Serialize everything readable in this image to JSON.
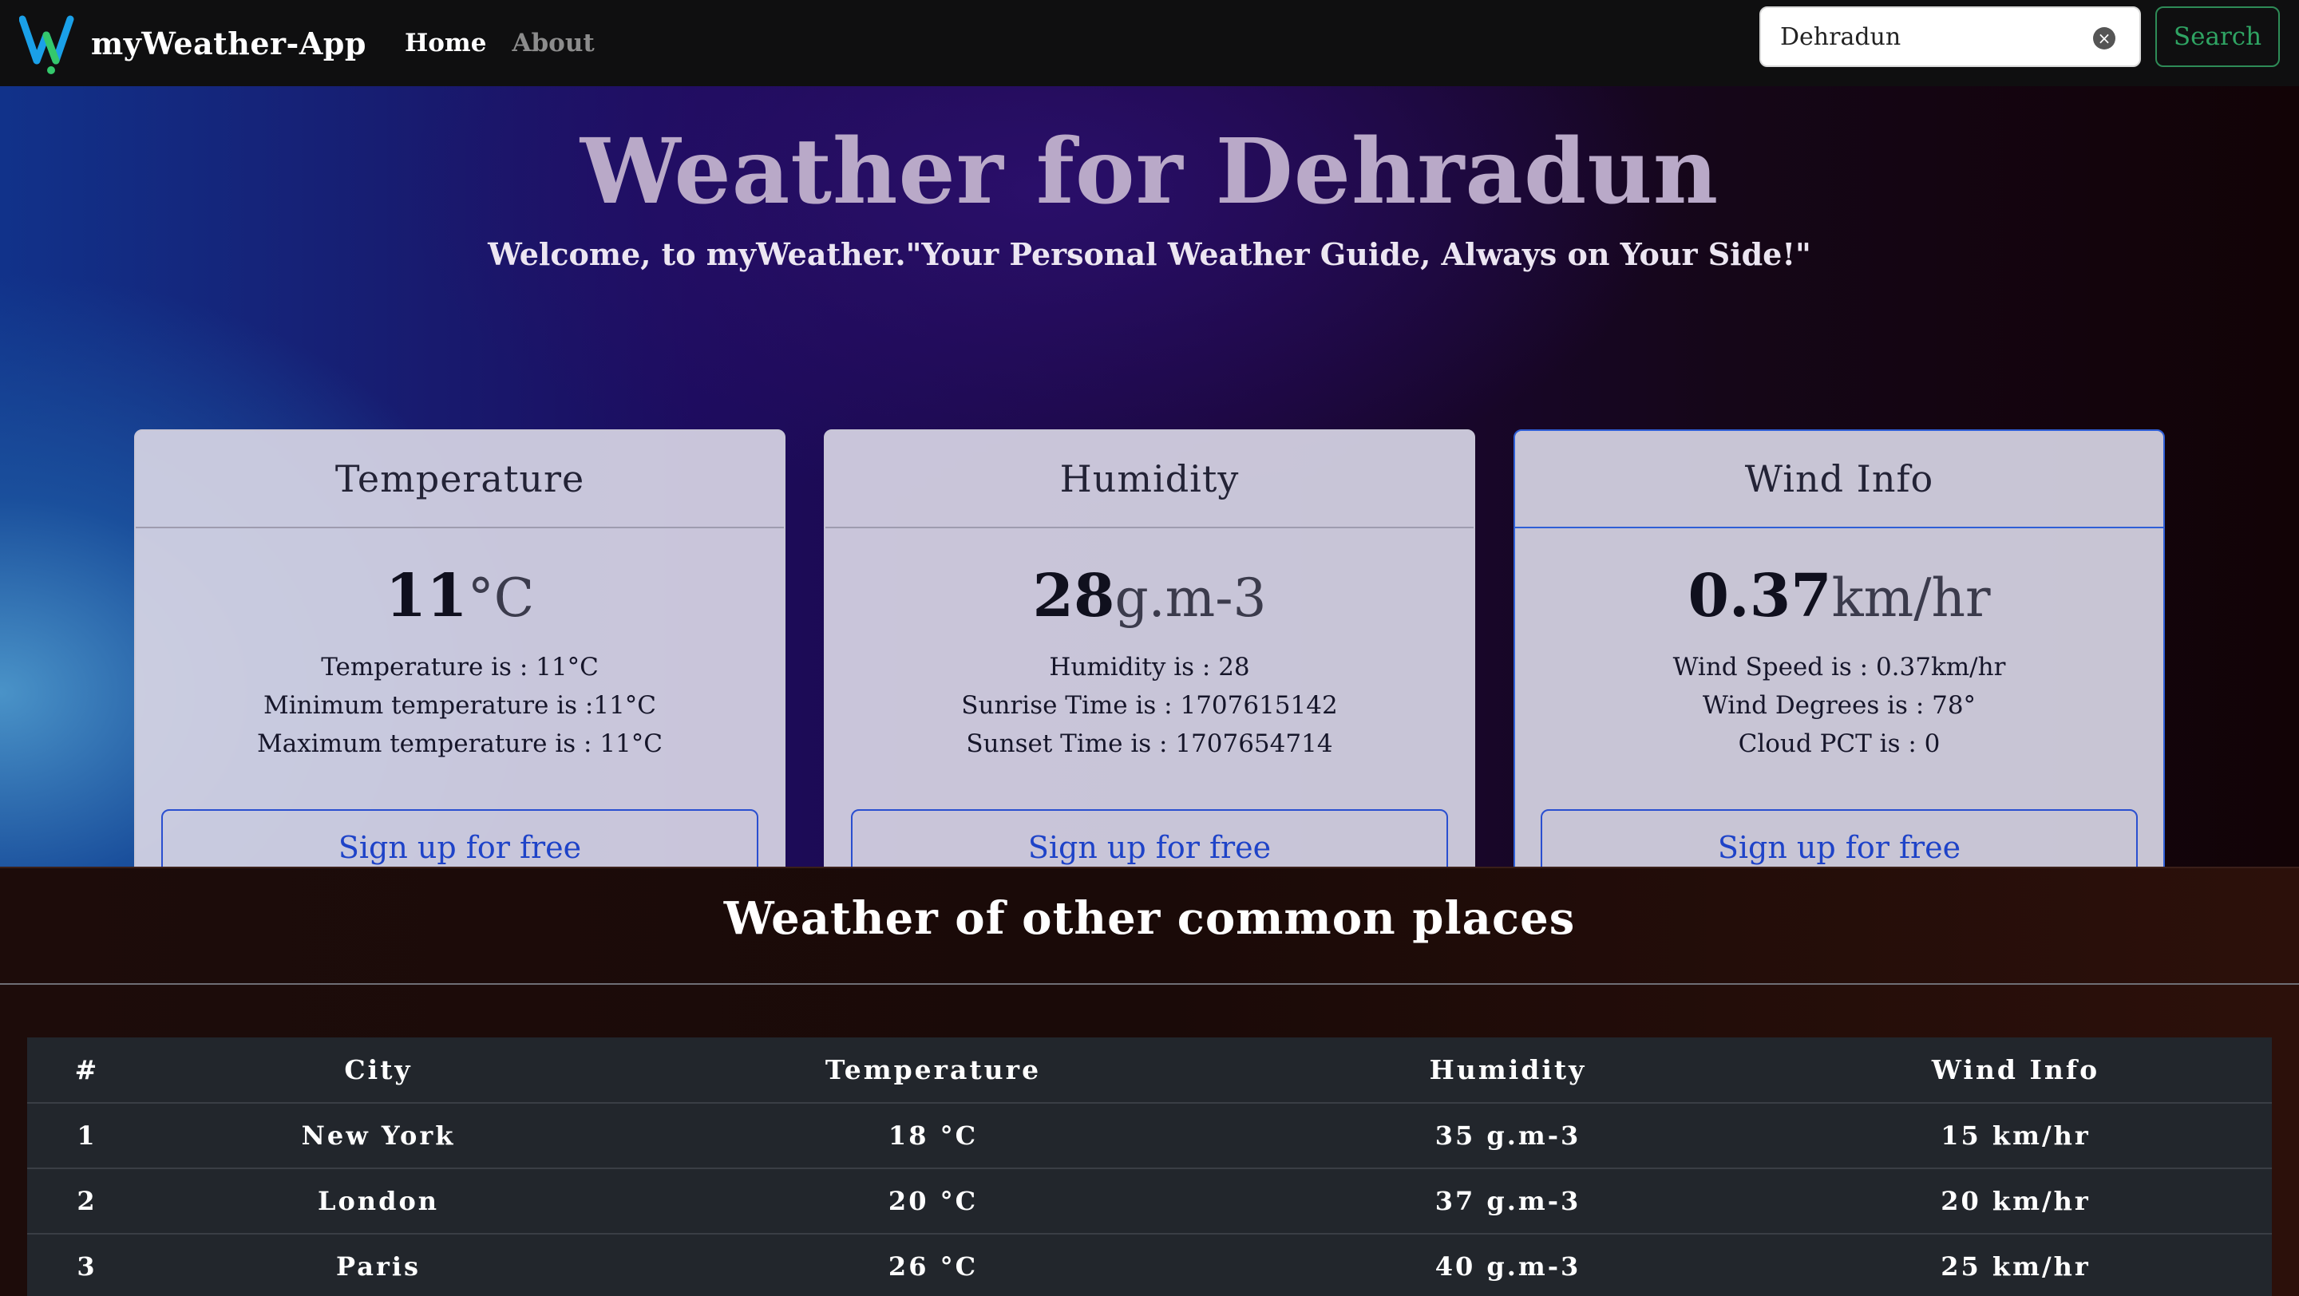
{
  "nav": {
    "brand": "myWeather-App",
    "home": "Home",
    "about": "About",
    "search_value": "Dehradun",
    "search_button": "Search",
    "clear_glyph": "×"
  },
  "hero": {
    "title": "Weather for Dehradun",
    "subtitle": "Welcome, to myWeather.\"Your Personal Weather Guide, Always on Your Side!\""
  },
  "cards": [
    {
      "title": "Temperature",
      "value": "11",
      "unit": "°C",
      "lines": [
        "Temperature is : 11°C",
        "Minimum temperature is :11°C",
        "Maximum temperature is : 11°C"
      ],
      "button": "Sign up for free"
    },
    {
      "title": "Humidity",
      "value": "28",
      "unit": "g.m-3",
      "lines": [
        "Humidity is : 28",
        "Sunrise Time is : 1707615142",
        "Sunset Time is : 1707654714"
      ],
      "button": "Sign up for free"
    },
    {
      "title": "Wind Info",
      "value": "0.37",
      "unit": "km/hr",
      "lines": [
        "Wind Speed is : 0.37km/hr",
        "Wind Degrees is : 78°",
        "Cloud PCT is : 0"
      ],
      "button": "Sign up for free"
    }
  ],
  "others": {
    "title": "Weather of other common places",
    "headers": [
      "#",
      "City",
      "Temperature",
      "Humidity",
      "Wind Info"
    ],
    "rows": [
      [
        "1",
        "New York",
        "18 °C",
        "35 g.m-3",
        "15 km/hr"
      ],
      [
        "2",
        "London",
        "20 °C",
        "37 g.m-3",
        "20 km/hr"
      ],
      [
        "3",
        "Paris",
        "26 °C",
        "40 g.m-3",
        "25 km/hr"
      ]
    ]
  },
  "colors": {
    "accent_blue": "#1e43c8",
    "search_green": "#2fa463",
    "logo_blue": "#1aa0e8",
    "logo_green": "#34c86c"
  },
  "icons": {
    "logo": "w-letter-logo",
    "clear": "clear-icon"
  }
}
